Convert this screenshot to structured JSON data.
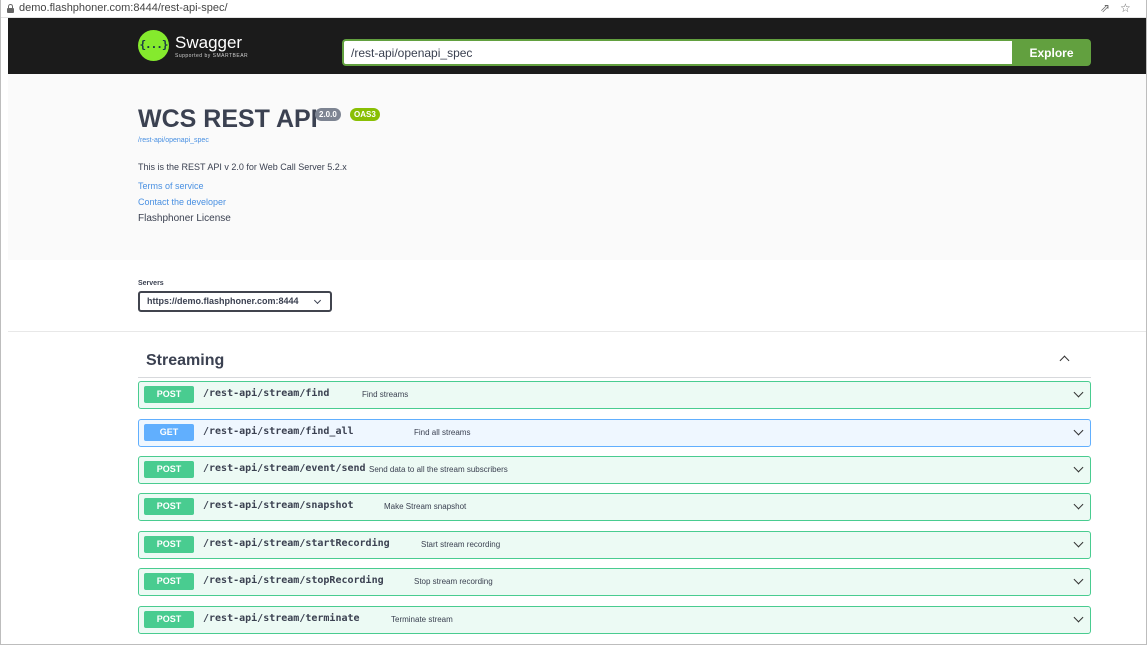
{
  "browser": {
    "url": "demo.flashphoner.com:8444/rest-api-spec/"
  },
  "topbar": {
    "logo_mark": "{...}",
    "logo_text": "Swagger",
    "logo_sub": "Supported by SMARTBEAR",
    "spec_url": "/rest-api/openapi_spec",
    "explore_label": "Explore"
  },
  "info": {
    "title": "WCS REST API",
    "version": "2.0.0",
    "oas": "OAS3",
    "spec_link": "/rest-api/openapi_spec",
    "description": "This is the REST API v 2.0 for Web Call Server 5.2.x",
    "terms_link": "Terms of service",
    "contact_link": "Contact the developer",
    "license": "Flashphoner License"
  },
  "servers": {
    "label": "Servers",
    "selected": "https://demo.flashphoner.com:8444"
  },
  "tag": {
    "name": "Streaming",
    "operations": [
      {
        "method": "POST",
        "path": "/rest-api/stream/find",
        "summary": "Find streams"
      },
      {
        "method": "GET",
        "path": "/rest-api/stream/find_all",
        "summary": "Find all streams"
      },
      {
        "method": "POST",
        "path": "/rest-api/stream/event/send",
        "summary": "Send data to all the stream subscribers"
      },
      {
        "method": "POST",
        "path": "/rest-api/stream/snapshot",
        "summary": "Make Stream snapshot"
      },
      {
        "method": "POST",
        "path": "/rest-api/stream/startRecording",
        "summary": "Start stream recording"
      },
      {
        "method": "POST",
        "path": "/rest-api/stream/stopRecording",
        "summary": "Stop stream recording"
      },
      {
        "method": "POST",
        "path": "/rest-api/stream/terminate",
        "summary": "Terminate stream"
      }
    ]
  },
  "colors": {
    "post": "#49cc90",
    "get": "#61affe",
    "brand": "#85ea2d",
    "explore": "#62a03f",
    "link": "#4990e2"
  }
}
